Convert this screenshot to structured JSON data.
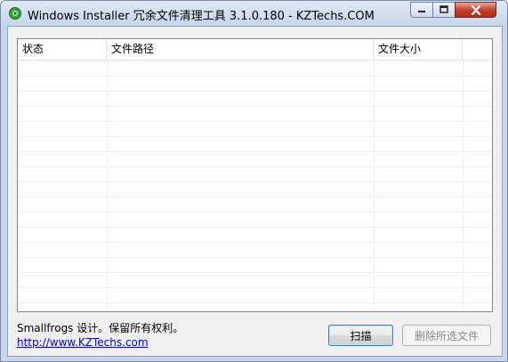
{
  "window": {
    "title": "Windows Installer 冗余文件清理工具 3.1.0.180 - KZTechs.COM",
    "icon": "green-gear-icon"
  },
  "listview": {
    "columns": [
      "状态",
      "文件路径",
      "文件大小"
    ],
    "rows": []
  },
  "footer": {
    "credit": "Smallfrogs 设计。保留所有权利。",
    "link": "http://www.KZTechs.com"
  },
  "buttons": {
    "scan": "扫描",
    "delete": "删除所选文件"
  },
  "colors": {
    "titlebar": "#c6d6eb",
    "close_button": "#c7432c",
    "link": "#0000ee"
  }
}
